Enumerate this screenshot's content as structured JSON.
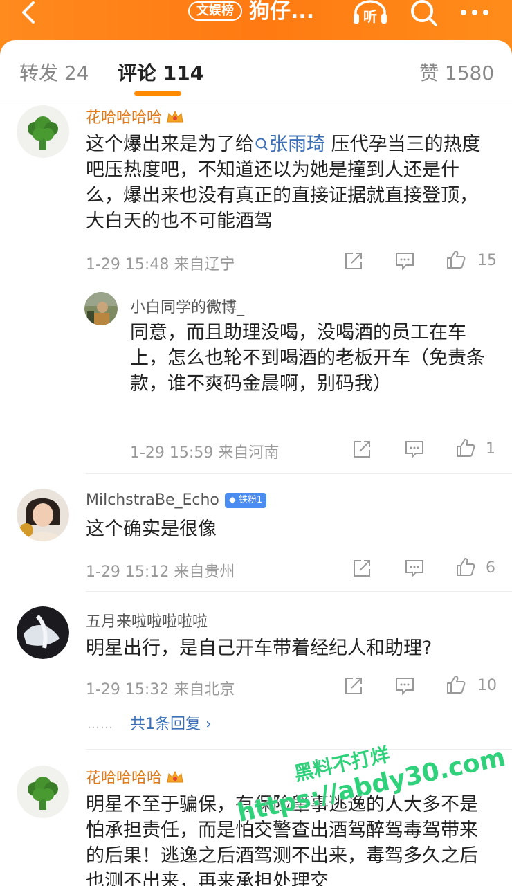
{
  "header": {
    "badge": "文娱榜",
    "title": "狗仔...",
    "icons": [
      "back-arrow-icon",
      "listen-icon",
      "search-icon",
      "more-icon"
    ],
    "listen_label": "听",
    "accent": "#ff8a1e"
  },
  "tabs": {
    "repost": "转发 24",
    "comments": "评论 114",
    "likes": "赞 1580"
  },
  "comments": [
    {
      "user": "花哈哈哈哈",
      "text_before": "这个爆出来是为了给",
      "mention": "张雨琦",
      "text_after": " 压代孕当三的热度吧压热度吧，不知道还以为她是撞到人还是什么，爆出来也没有真正的直接证据就直接登顶，大白天的也不可能酒驾",
      "time": "1-29 15:48  来自辽宁",
      "likes": "15",
      "reply": {
        "user": "小白同学的微博_",
        "text": "同意，而且助理没喝，没喝酒的员工在车上，怎么也轮不到喝酒的老板开车（免责条款，谁不爽码金晨啊，别码我）",
        "time": "1-29 15:59  来自河南",
        "likes": "1"
      }
    },
    {
      "user": "MilchstraBe_Echo",
      "badge": "铁粉1",
      "text": "这个确实是很像",
      "time": "1-29 15:12  来自贵州",
      "likes": "6"
    },
    {
      "user": "五月来啦啦啦啦啦",
      "text": "明星出行，是自己开车带着经纪人和助理?",
      "time": "1-29 15:32  来自北京",
      "likes": "10",
      "dots": "……",
      "replies_link": "共1条回复 ›"
    },
    {
      "user": "花哈哈哈哈",
      "text": "明星不至于骗保，有保险肇事逃逸的人大多不是怕承担责任，而是怕交警查出酒驾醉驾毒驾带来的后果！逃逸之后酒驾测不出来，毒驾多久之后也测不出来，再来承担处理交"
    }
  ],
  "watermark": {
    "line1": "黑料不打烊",
    "line2": "https://abdy30.com"
  }
}
